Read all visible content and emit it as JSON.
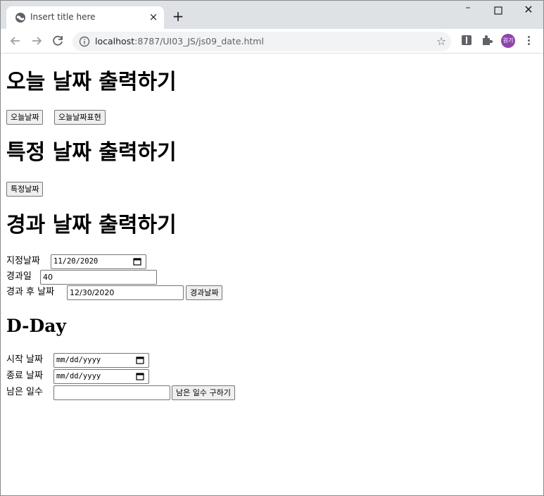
{
  "browser": {
    "tab_title": "Insert title here",
    "tab_close": "×",
    "new_tab": "+",
    "window_minimize": "–",
    "window_maximize": "☐",
    "window_close": "✕",
    "url_host": "localhost",
    "url_path": ":8787/UI03_JS/js09_date.html",
    "profile_initials": "원기",
    "profile_color": "#8e44ad"
  },
  "sections": {
    "today_heading": "오늘 날짜 출력하기",
    "today_button": "오늘날짜",
    "today_expr_button": "오늘날짜표현",
    "specific_heading": "특정 날짜 출력하기",
    "specific_button": "특정날짜",
    "elapsed_heading": "경과 날짜 출력하기",
    "elapsed": {
      "date_label": "지정날짜",
      "date_value": "11/20/2020",
      "days_label": "경과일",
      "days_value": "40",
      "after_label": "경과 후 날짜",
      "after_value": "12/30/2020",
      "button": "경과날짜"
    },
    "dday_heading": "D-Day",
    "dday": {
      "start_label": "시작 날짜",
      "start_placeholder": "mm/dd/yyyy",
      "end_label": "종료 날짜",
      "end_placeholder": "mm/dd/yyyy",
      "remaining_label": "남은 일수",
      "remaining_value": "",
      "button": "남은 일수 구하기"
    }
  },
  "icons": [
    "globe-icon",
    "back-icon",
    "forward-icon",
    "reload-icon",
    "info-icon",
    "star-icon",
    "extension-icon",
    "puzzle-icon",
    "menu-icon",
    "calendar-icon"
  ]
}
